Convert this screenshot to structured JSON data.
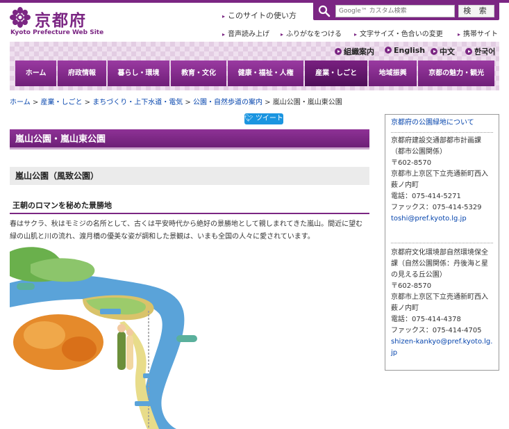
{
  "site": {
    "logo_ja": "京都府",
    "logo_en": "Kyoto Prefecture Web Site",
    "accent_color": "#7b2683"
  },
  "utility": {
    "how_to_use": "このサイトの使い方",
    "read_aloud": "音声読み上げ",
    "furigana": "ふりがなをつける",
    "text_size": "文字サイズ・色合いの変更",
    "mobile": "携帯サイト"
  },
  "search": {
    "placeholder": "Google™ カスタム検索",
    "button": "検 索"
  },
  "languages": [
    "組織案内",
    "English",
    "中文",
    "한국어"
  ],
  "nav": [
    {
      "label": "ホーム"
    },
    {
      "label": "府政情報"
    },
    {
      "label": "暮らし・環境"
    },
    {
      "label": "教育・文化"
    },
    {
      "label": "健康・福祉・人権"
    },
    {
      "label": "産業・しごと"
    },
    {
      "label": "地域振興"
    },
    {
      "label": "京都の魅力・観光"
    }
  ],
  "breadcrumb": {
    "items": [
      "ホーム",
      "産業・しごと",
      "まちづくり・上下水道・電気",
      "公園・自然歩道の案内"
    ],
    "current": "嵐山公園・嵐山東公園"
  },
  "tweet": "ツイート",
  "page": {
    "title": "嵐山公園・嵐山東公園",
    "section_title": "嵐山公園（風致公園）",
    "subsection_title": "王朝のロマンを秘めた景勝地",
    "body_text": "春はサクラ、秋はモミジの名所として、古くは平安時代から絶好の景勝地として親しまれてきた嵐山。間近に望む緑の山肌と川の流れ、渡月橋の優美な姿が調和した景観は、いまも全国の人々に愛されています。"
  },
  "sidebar": {
    "title": "京都府の公園緑地について",
    "contact1": {
      "dept": "京都府建設交通部都市計画課（都市公園関係）",
      "zip": "〒602-8570",
      "address": "京都市上京区下立売通新町西入薮ノ内町",
      "tel": "電話：075-414-5271",
      "fax": "ファックス：075-414-5329",
      "email": "toshi@pref.kyoto.lg.jp"
    },
    "contact2": {
      "dept": "京都府文化環境部自然環境保全課（自然公園関係：丹後海と星の見える丘公園）",
      "zip": "〒602-8570",
      "address": "京都市上京区下立売通新町西入薮ノ内町",
      "tel": "電話：075-414-4378",
      "fax": "ファックス：075-414-4705",
      "email": "shizen-kankyo@pref.kyoto.lg.jp"
    }
  }
}
